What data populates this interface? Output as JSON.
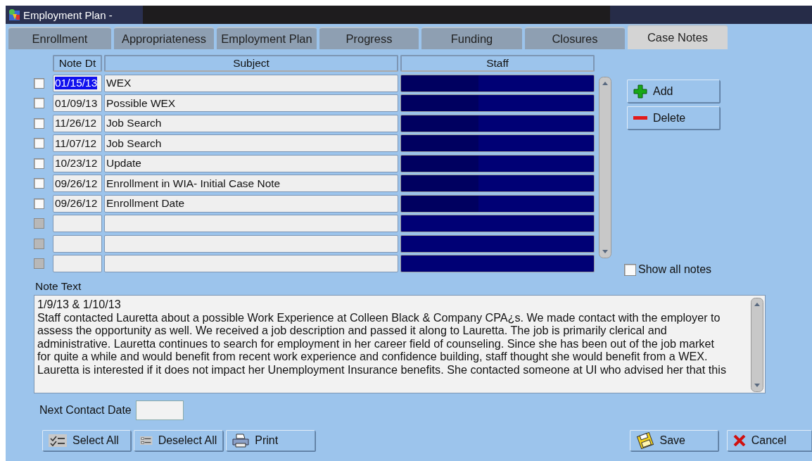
{
  "window": {
    "title": "Employment Plan -"
  },
  "tabs": [
    {
      "label": "Enrollment",
      "selected": false
    },
    {
      "label": "Appropriateness",
      "selected": false
    },
    {
      "label": "Employment Plan",
      "selected": false
    },
    {
      "label": "Progress",
      "selected": false
    },
    {
      "label": "Funding",
      "selected": false
    },
    {
      "label": "Closures",
      "selected": false
    },
    {
      "label": "Case Notes",
      "selected": true
    }
  ],
  "table": {
    "columns": [
      "Note Dt",
      "Subject",
      "Staff"
    ],
    "rows": [
      {
        "kind": "note",
        "date": "01/15/13",
        "subject": "WEX",
        "checked": false,
        "disabled": false,
        "selected": true
      },
      {
        "kind": "note",
        "date": "01/09/13",
        "subject": "Possible WEX",
        "checked": false,
        "disabled": false,
        "selected": false
      },
      {
        "kind": "note",
        "date": "11/26/12",
        "subject": "Job Search",
        "checked": false,
        "disabled": false,
        "selected": false
      },
      {
        "kind": "note",
        "date": "11/07/12",
        "subject": "Job Search",
        "checked": false,
        "disabled": false,
        "selected": false
      },
      {
        "kind": "note",
        "date": "10/23/12",
        "subject": "Update",
        "checked": false,
        "disabled": false,
        "selected": false
      },
      {
        "kind": "note",
        "date": "09/26/12",
        "subject": "Enrollment in WIA- Initial Case Note",
        "checked": false,
        "disabled": false,
        "selected": false
      },
      {
        "kind": "note",
        "date": "09/26/12",
        "subject": "Enrollment Date",
        "checked": false,
        "disabled": false,
        "selected": false
      },
      {
        "kind": "blank",
        "checked": false,
        "disabled": true,
        "selected": false
      },
      {
        "kind": "blank",
        "checked": false,
        "disabled": true,
        "selected": false
      },
      {
        "kind": "blank",
        "checked": false,
        "disabled": true,
        "selected": false
      }
    ]
  },
  "side_buttons": [
    {
      "kind": "add",
      "label": "Add"
    },
    {
      "kind": "delete",
      "label": "Delete"
    }
  ],
  "show_all_notes": {
    "label": "Show all notes",
    "checked": false
  },
  "note_text": {
    "label": "Note Text",
    "lines": [
      "1/9/13 & 1/10/13",
      "Staff contacted Lauretta about a possible Work Experience at Colleen Black & Company CPA¿s. We made contact with the employer to",
      "assess the opportunity as well. We received a job description and passed it along to Lauretta. The job is primarily clerical and",
      "administrative. Lauretta continues to search for employment in her career field of counseling. Since she has been out of the job market",
      "for quite a while and would benefit from recent work experience and confidence building, staff thought she would benefit from a WEX.",
      "Lauretta is interested if it does not impact her Unemployment Insurance benefits. She contacted someone at UI who advised her that this"
    ]
  },
  "next_contact_date": {
    "label": "Next Contact Date"
  },
  "bottom_buttons": [
    {
      "kind": "select_all",
      "label": "Select All"
    },
    {
      "kind": "deselect_all",
      "label": "Deselect All"
    },
    {
      "kind": "print",
      "label": "Print"
    },
    {
      "kind": "save",
      "label": "Save"
    },
    {
      "kind": "cancel",
      "label": "Cancel"
    }
  ]
}
